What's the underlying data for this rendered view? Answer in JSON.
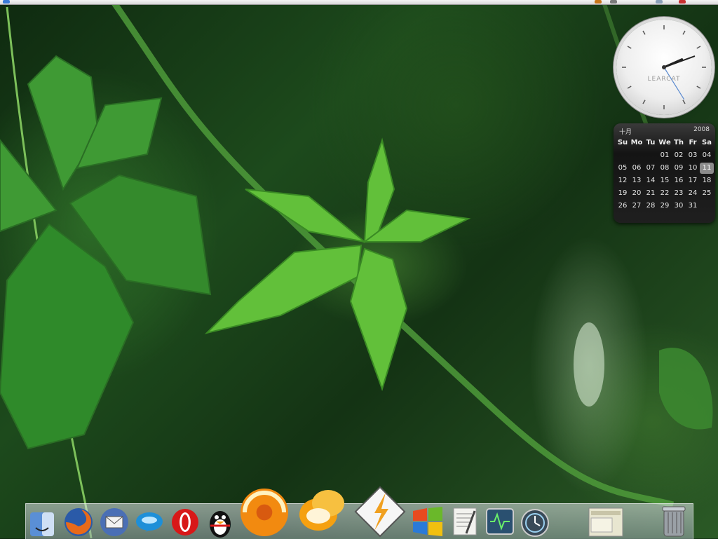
{
  "menubar": {
    "tray_icons": [
      "apple-menu-icon",
      "network-icon",
      "volume-icon",
      "battery-icon",
      "clock-tray-icon"
    ]
  },
  "clock_widget": {
    "brand": "LEARCAT",
    "hour_hand_deg": 66,
    "minute_hand_deg": 70,
    "second_hand_deg": 148
  },
  "calendar_widget": {
    "month": "十月",
    "year": "2008",
    "weekdays": [
      "Su",
      "Mo",
      "Tu",
      "We",
      "Th",
      "Fr",
      "Sa"
    ],
    "weeks": [
      [
        "",
        "",
        "",
        "01",
        "02",
        "03",
        "04"
      ],
      [
        "05",
        "06",
        "07",
        "08",
        "09",
        "10",
        "11"
      ],
      [
        "12",
        "13",
        "14",
        "15",
        "16",
        "17",
        "18"
      ],
      [
        "19",
        "20",
        "21",
        "22",
        "23",
        "24",
        "25"
      ],
      [
        "26",
        "27",
        "28",
        "29",
        "30",
        "31",
        ""
      ]
    ],
    "today": "11"
  },
  "dock": {
    "items": [
      {
        "name": "finder-icon",
        "color": "#5a8fd6"
      },
      {
        "name": "firefox-icon",
        "color": "#e86a1a"
      },
      {
        "name": "mail-icon",
        "color": "#4a6fb5"
      },
      {
        "name": "chat-bubble-icon",
        "color": "#1e8fd8"
      },
      {
        "name": "opera-icon",
        "color": "#d81818"
      },
      {
        "name": "qq-penguin-icon",
        "color": "#111111"
      },
      {
        "name": "swirl-app-icon",
        "color": "#f28a10"
      },
      {
        "name": "messenger-icon",
        "color": "#f5a010"
      },
      {
        "name": "winamp-icon",
        "color": "#f0a020"
      },
      {
        "name": "windows-icon",
        "color": "#2a7ad8"
      },
      {
        "name": "text-editor-icon",
        "color": "#f2f2ee"
      },
      {
        "name": "activity-monitor-icon",
        "color": "#2a5070"
      },
      {
        "name": "time-machine-icon",
        "color": "#3a4a58"
      },
      {
        "name": "window-thumbnail-icon",
        "color": "#e8e6d0"
      },
      {
        "name": "trash-icon",
        "color": "#9aa0a6"
      }
    ]
  }
}
